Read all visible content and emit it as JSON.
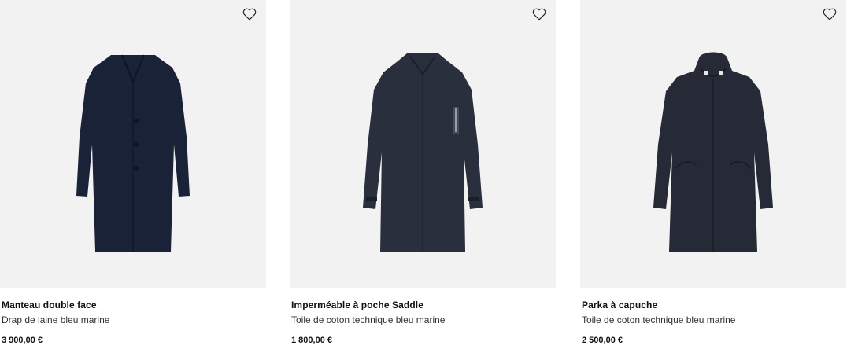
{
  "products": [
    {
      "name": "Manteau double face",
      "description": "Drap de laine bleu marine",
      "price": "3 900,00 €",
      "icon": "heart-outline-icon",
      "color": "#1a2238"
    },
    {
      "name": "Imperméable à poche Saddle",
      "description": "Toile de coton technique bleu marine",
      "price": "1 800,00 €",
      "icon": "heart-outline-icon",
      "color": "#2a2f3d"
    },
    {
      "name": "Parka à capuche",
      "description": "Toile de coton technique bleu marine",
      "price": "2 500,00 €",
      "icon": "heart-outline-icon",
      "color": "#262a36"
    }
  ]
}
